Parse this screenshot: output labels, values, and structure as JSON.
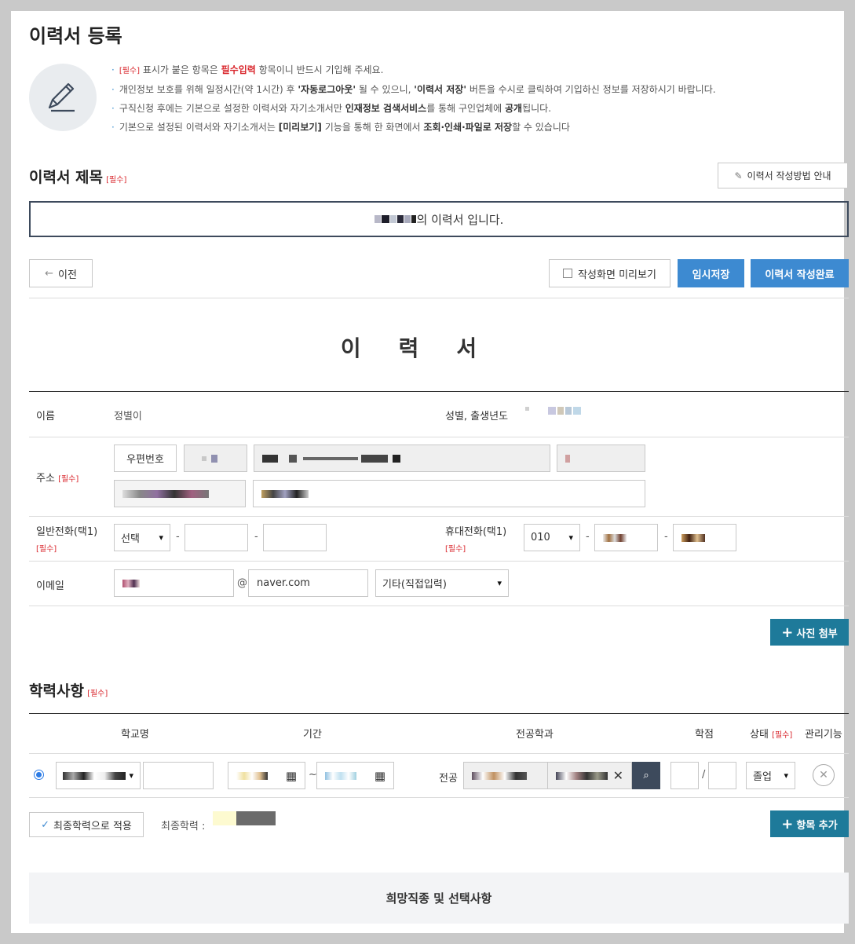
{
  "page_title": "이력서 등록",
  "notices": [
    {
      "parts": [
        {
          "t": "[필수]",
          "c": "req"
        },
        {
          "t": " 표시가 붙은 항목은 ",
          "c": ""
        },
        {
          "t": "필수입력",
          "c": "red"
        },
        {
          "t": " 항목이니 반드시 기입해 주세요.",
          "c": ""
        }
      ]
    },
    {
      "parts": [
        {
          "t": "개인정보 보호를 위해 일정시간(약 1시간) 후 ",
          "c": ""
        },
        {
          "t": "'자동로그아웃'",
          "c": "bold"
        },
        {
          "t": " 될 수 있으니, ",
          "c": ""
        },
        {
          "t": "'이력서 저장'",
          "c": "bold"
        },
        {
          "t": " 버튼을 수시로 클릭하여 기입하신 정보를 저장하시기 바랍니다.",
          "c": ""
        }
      ]
    },
    {
      "parts": [
        {
          "t": "구직신청 후에는 기본으로 설정한 이력서와 자기소개서만 ",
          "c": ""
        },
        {
          "t": "인재정보 검색서비스",
          "c": "bold"
        },
        {
          "t": "를 통해 구인업체에 ",
          "c": ""
        },
        {
          "t": "공개",
          "c": "bold"
        },
        {
          "t": "됩니다.",
          "c": ""
        }
      ]
    },
    {
      "parts": [
        {
          "t": "기본으로 설정된 이력서와 자기소개서는 ",
          "c": ""
        },
        {
          "t": "[미리보기]",
          "c": "bold"
        },
        {
          "t": " 기능을 통해 한 화면에서 ",
          "c": ""
        },
        {
          "t": "조회·인쇄·파일로 저장",
          "c": "bold"
        },
        {
          "t": "할 수 있습니다",
          "c": ""
        }
      ]
    }
  ],
  "resume_title_section": {
    "heading": "이력서 제목",
    "required": "[필수]",
    "guide_button": "이력서 작성방법 안내",
    "title_suffix": "의 이력서 입니다."
  },
  "actions": {
    "prev": "이전",
    "preview": "작성화면 미리보기",
    "temp_save": "임시저장",
    "complete": "이력서 작성완료"
  },
  "resume_heading": "이력서",
  "personal": {
    "name_label": "이름",
    "name_value": "정별이",
    "gender_label": "성별, 출생년도",
    "address_label": "주소",
    "address_required": "[필수]",
    "zip_button": "우편번호",
    "phone_label": "일반전화(택1)",
    "phone_required": "[필수]",
    "phone_select": "선택",
    "mobile_label": "휴대전화(택1)",
    "mobile_required": "[필수]",
    "mobile_prefix": "010",
    "email_label": "이메일",
    "email_at": "@",
    "email_domain": "naver.com",
    "email_select": "기타(직접입력)"
  },
  "photo_button": "사진 첨부",
  "education": {
    "heading": "학력사항",
    "required": "[필수]",
    "columns": [
      "학교명",
      "기간",
      "전공학과",
      "학점",
      "상태",
      "관리기능"
    ],
    "status_required": "[필수]",
    "period_sep": "~",
    "major_label": "전공",
    "grade_sep": "/",
    "status_value": "졸업",
    "final_button": "최종학력으로 적용",
    "final_label": "최종학력 :",
    "add_button": "항목 추가"
  },
  "footer_section": "희망직종 및 선택사항",
  "colors": {
    "accent_blue": "#3d8ad1",
    "teal": "#1e7a9a",
    "required_red": "#d9262c"
  }
}
